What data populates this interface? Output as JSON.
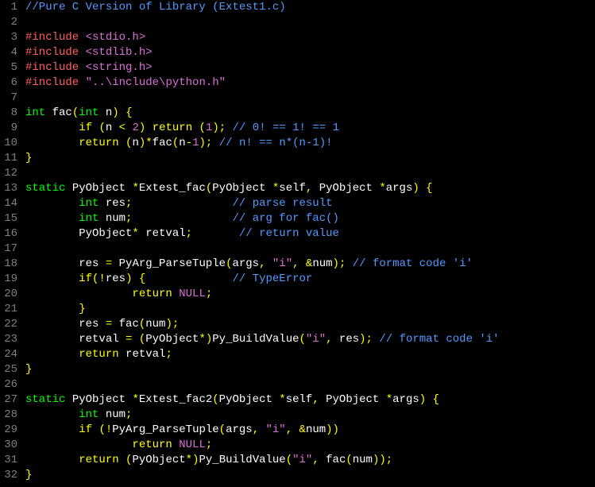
{
  "lines": [
    {
      "num": "1",
      "tokens": [
        {
          "t": "//Pure C Version of Library (Extest1.c)",
          "c": "c-blu"
        }
      ]
    },
    {
      "num": "2",
      "tokens": []
    },
    {
      "num": "3",
      "tokens": [
        {
          "t": "#include",
          "c": "c-red"
        },
        {
          "t": " ",
          "c": "c-white"
        },
        {
          "t": "<stdio.h>",
          "c": "c-purple"
        }
      ]
    },
    {
      "num": "4",
      "tokens": [
        {
          "t": "#include",
          "c": "c-red"
        },
        {
          "t": " ",
          "c": "c-white"
        },
        {
          "t": "<stdlib.h>",
          "c": "c-purple"
        }
      ]
    },
    {
      "num": "5",
      "tokens": [
        {
          "t": "#include",
          "c": "c-red"
        },
        {
          "t": " ",
          "c": "c-white"
        },
        {
          "t": "<string.h>",
          "c": "c-purple"
        }
      ]
    },
    {
      "num": "6",
      "tokens": [
        {
          "t": "#include",
          "c": "c-red"
        },
        {
          "t": " ",
          "c": "c-white"
        },
        {
          "t": "\"..\\include\\python.h\"",
          "c": "c-purple"
        }
      ]
    },
    {
      "num": "7",
      "tokens": []
    },
    {
      "num": "8",
      "tokens": [
        {
          "t": "int",
          "c": "c-green"
        },
        {
          "t": " ",
          "c": "c-white"
        },
        {
          "t": "fac",
          "c": "c-white"
        },
        {
          "t": "(",
          "c": "c-yellow"
        },
        {
          "t": "int",
          "c": "c-green"
        },
        {
          "t": " n",
          "c": "c-white"
        },
        {
          "t": ")",
          "c": "c-yellow"
        },
        {
          "t": " ",
          "c": "c-white"
        },
        {
          "t": "{",
          "c": "c-yellow"
        }
      ]
    },
    {
      "num": "9",
      "tokens": [
        {
          "t": "        ",
          "c": "c-white"
        },
        {
          "t": "if",
          "c": "c-yellow"
        },
        {
          "t": " ",
          "c": "c-white"
        },
        {
          "t": "(",
          "c": "c-yellow"
        },
        {
          "t": "n ",
          "c": "c-white"
        },
        {
          "t": "<",
          "c": "c-yellow"
        },
        {
          "t": " ",
          "c": "c-white"
        },
        {
          "t": "2",
          "c": "c-purple"
        },
        {
          "t": ")",
          "c": "c-yellow"
        },
        {
          "t": " ",
          "c": "c-white"
        },
        {
          "t": "return",
          "c": "c-yellow"
        },
        {
          "t": " ",
          "c": "c-white"
        },
        {
          "t": "(",
          "c": "c-yellow"
        },
        {
          "t": "1",
          "c": "c-purple"
        },
        {
          "t": ")",
          "c": "c-yellow"
        },
        {
          "t": ";",
          "c": "c-yellow"
        },
        {
          "t": " ",
          "c": "c-white"
        },
        {
          "t": "// 0! == 1! == 1",
          "c": "c-blu"
        }
      ]
    },
    {
      "num": "10",
      "tokens": [
        {
          "t": "        ",
          "c": "c-white"
        },
        {
          "t": "return",
          "c": "c-yellow"
        },
        {
          "t": " ",
          "c": "c-white"
        },
        {
          "t": "(",
          "c": "c-yellow"
        },
        {
          "t": "n",
          "c": "c-white"
        },
        {
          "t": ")*",
          "c": "c-yellow"
        },
        {
          "t": "fac",
          "c": "c-white"
        },
        {
          "t": "(",
          "c": "c-yellow"
        },
        {
          "t": "n",
          "c": "c-white"
        },
        {
          "t": "-",
          "c": "c-yellow"
        },
        {
          "t": "1",
          "c": "c-purple"
        },
        {
          "t": ");",
          "c": "c-yellow"
        },
        {
          "t": " ",
          "c": "c-white"
        },
        {
          "t": "// n! == n*(n-1)!",
          "c": "c-blu"
        }
      ]
    },
    {
      "num": "11",
      "tokens": [
        {
          "t": "}",
          "c": "c-yellow"
        }
      ]
    },
    {
      "num": "12",
      "tokens": []
    },
    {
      "num": "13",
      "tokens": [
        {
          "t": "static",
          "c": "c-green"
        },
        {
          "t": " PyObject ",
          "c": "c-white"
        },
        {
          "t": "*",
          "c": "c-yellow"
        },
        {
          "t": "Extest_fac",
          "c": "c-white"
        },
        {
          "t": "(",
          "c": "c-yellow"
        },
        {
          "t": "PyObject ",
          "c": "c-white"
        },
        {
          "t": "*",
          "c": "c-yellow"
        },
        {
          "t": "self",
          "c": "c-white"
        },
        {
          "t": ",",
          "c": "c-yellow"
        },
        {
          "t": " PyObject ",
          "c": "c-white"
        },
        {
          "t": "*",
          "c": "c-yellow"
        },
        {
          "t": "args",
          "c": "c-white"
        },
        {
          "t": ")",
          "c": "c-yellow"
        },
        {
          "t": " ",
          "c": "c-white"
        },
        {
          "t": "{",
          "c": "c-yellow"
        }
      ]
    },
    {
      "num": "14",
      "tokens": [
        {
          "t": "        ",
          "c": "c-white"
        },
        {
          "t": "int",
          "c": "c-green"
        },
        {
          "t": " res",
          "c": "c-white"
        },
        {
          "t": ";",
          "c": "c-yellow"
        },
        {
          "t": "               ",
          "c": "c-white"
        },
        {
          "t": "// parse result",
          "c": "c-blu"
        }
      ]
    },
    {
      "num": "15",
      "tokens": [
        {
          "t": "        ",
          "c": "c-white"
        },
        {
          "t": "int",
          "c": "c-green"
        },
        {
          "t": " num",
          "c": "c-white"
        },
        {
          "t": ";",
          "c": "c-yellow"
        },
        {
          "t": "               ",
          "c": "c-white"
        },
        {
          "t": "// arg for fac()",
          "c": "c-blu"
        }
      ]
    },
    {
      "num": "16",
      "tokens": [
        {
          "t": "        PyObject",
          "c": "c-white"
        },
        {
          "t": "*",
          "c": "c-yellow"
        },
        {
          "t": " retval",
          "c": "c-white"
        },
        {
          "t": ";",
          "c": "c-yellow"
        },
        {
          "t": "       ",
          "c": "c-white"
        },
        {
          "t": "// return value",
          "c": "c-blu"
        }
      ]
    },
    {
      "num": "17",
      "tokens": []
    },
    {
      "num": "18",
      "tokens": [
        {
          "t": "        res ",
          "c": "c-white"
        },
        {
          "t": "=",
          "c": "c-yellow"
        },
        {
          "t": " PyArg_ParseTuple",
          "c": "c-white"
        },
        {
          "t": "(",
          "c": "c-yellow"
        },
        {
          "t": "args",
          "c": "c-white"
        },
        {
          "t": ",",
          "c": "c-yellow"
        },
        {
          "t": " ",
          "c": "c-white"
        },
        {
          "t": "\"i\"",
          "c": "c-purple"
        },
        {
          "t": ",",
          "c": "c-yellow"
        },
        {
          "t": " ",
          "c": "c-white"
        },
        {
          "t": "&",
          "c": "c-yellow"
        },
        {
          "t": "num",
          "c": "c-white"
        },
        {
          "t": ");",
          "c": "c-yellow"
        },
        {
          "t": " ",
          "c": "c-white"
        },
        {
          "t": "// format code 'i'",
          "c": "c-blu"
        }
      ]
    },
    {
      "num": "19",
      "tokens": [
        {
          "t": "        ",
          "c": "c-white"
        },
        {
          "t": "if",
          "c": "c-yellow"
        },
        {
          "t": "(!",
          "c": "c-yellow"
        },
        {
          "t": "res",
          "c": "c-white"
        },
        {
          "t": ")",
          "c": "c-yellow"
        },
        {
          "t": " ",
          "c": "c-white"
        },
        {
          "t": "{",
          "c": "c-yellow"
        },
        {
          "t": "             ",
          "c": "c-white"
        },
        {
          "t": "// TypeError",
          "c": "c-blu"
        }
      ]
    },
    {
      "num": "20",
      "tokens": [
        {
          "t": "                ",
          "c": "c-white"
        },
        {
          "t": "return",
          "c": "c-yellow"
        },
        {
          "t": " ",
          "c": "c-white"
        },
        {
          "t": "NULL",
          "c": "c-purple"
        },
        {
          "t": ";",
          "c": "c-yellow"
        }
      ]
    },
    {
      "num": "21",
      "tokens": [
        {
          "t": "        ",
          "c": "c-white"
        },
        {
          "t": "}",
          "c": "c-yellow"
        }
      ]
    },
    {
      "num": "22",
      "tokens": [
        {
          "t": "        res ",
          "c": "c-white"
        },
        {
          "t": "=",
          "c": "c-yellow"
        },
        {
          "t": " fac",
          "c": "c-white"
        },
        {
          "t": "(",
          "c": "c-yellow"
        },
        {
          "t": "num",
          "c": "c-white"
        },
        {
          "t": ");",
          "c": "c-yellow"
        }
      ]
    },
    {
      "num": "23",
      "tokens": [
        {
          "t": "        retval ",
          "c": "c-white"
        },
        {
          "t": "=",
          "c": "c-yellow"
        },
        {
          "t": " ",
          "c": "c-white"
        },
        {
          "t": "(",
          "c": "c-yellow"
        },
        {
          "t": "PyObject",
          "c": "c-white"
        },
        {
          "t": "*)",
          "c": "c-yellow"
        },
        {
          "t": "Py_BuildValue",
          "c": "c-white"
        },
        {
          "t": "(",
          "c": "c-yellow"
        },
        {
          "t": "\"i\"",
          "c": "c-purple"
        },
        {
          "t": ",",
          "c": "c-yellow"
        },
        {
          "t": " res",
          "c": "c-white"
        },
        {
          "t": ");",
          "c": "c-yellow"
        },
        {
          "t": " ",
          "c": "c-white"
        },
        {
          "t": "// format code 'i'",
          "c": "c-blu"
        }
      ]
    },
    {
      "num": "24",
      "tokens": [
        {
          "t": "        ",
          "c": "c-white"
        },
        {
          "t": "return",
          "c": "c-yellow"
        },
        {
          "t": " retval",
          "c": "c-white"
        },
        {
          "t": ";",
          "c": "c-yellow"
        }
      ]
    },
    {
      "num": "25",
      "tokens": [
        {
          "t": "}",
          "c": "c-yellow"
        }
      ]
    },
    {
      "num": "26",
      "tokens": []
    },
    {
      "num": "27",
      "tokens": [
        {
          "t": "static",
          "c": "c-green"
        },
        {
          "t": " PyObject ",
          "c": "c-white"
        },
        {
          "t": "*",
          "c": "c-yellow"
        },
        {
          "t": "Extest_fac2",
          "c": "c-white"
        },
        {
          "t": "(",
          "c": "c-yellow"
        },
        {
          "t": "PyObject ",
          "c": "c-white"
        },
        {
          "t": "*",
          "c": "c-yellow"
        },
        {
          "t": "self",
          "c": "c-white"
        },
        {
          "t": ",",
          "c": "c-yellow"
        },
        {
          "t": " PyObject ",
          "c": "c-white"
        },
        {
          "t": "*",
          "c": "c-yellow"
        },
        {
          "t": "args",
          "c": "c-white"
        },
        {
          "t": ")",
          "c": "c-yellow"
        },
        {
          "t": " ",
          "c": "c-white"
        },
        {
          "t": "{",
          "c": "c-yellow"
        }
      ]
    },
    {
      "num": "28",
      "tokens": [
        {
          "t": "        ",
          "c": "c-white"
        },
        {
          "t": "int",
          "c": "c-green"
        },
        {
          "t": " num",
          "c": "c-white"
        },
        {
          "t": ";",
          "c": "c-yellow"
        }
      ]
    },
    {
      "num": "29",
      "tokens": [
        {
          "t": "        ",
          "c": "c-white"
        },
        {
          "t": "if",
          "c": "c-yellow"
        },
        {
          "t": " ",
          "c": "c-white"
        },
        {
          "t": "(!",
          "c": "c-yellow"
        },
        {
          "t": "PyArg_ParseTuple",
          "c": "c-white"
        },
        {
          "t": "(",
          "c": "c-yellow"
        },
        {
          "t": "args",
          "c": "c-white"
        },
        {
          "t": ",",
          "c": "c-yellow"
        },
        {
          "t": " ",
          "c": "c-white"
        },
        {
          "t": "\"i\"",
          "c": "c-purple"
        },
        {
          "t": ",",
          "c": "c-yellow"
        },
        {
          "t": " ",
          "c": "c-white"
        },
        {
          "t": "&",
          "c": "c-yellow"
        },
        {
          "t": "num",
          "c": "c-white"
        },
        {
          "t": "))",
          "c": "c-yellow"
        }
      ]
    },
    {
      "num": "30",
      "tokens": [
        {
          "t": "                ",
          "c": "c-white"
        },
        {
          "t": "return",
          "c": "c-yellow"
        },
        {
          "t": " ",
          "c": "c-white"
        },
        {
          "t": "NULL",
          "c": "c-purple"
        },
        {
          "t": ";",
          "c": "c-yellow"
        }
      ]
    },
    {
      "num": "31",
      "tokens": [
        {
          "t": "        ",
          "c": "c-white"
        },
        {
          "t": "return",
          "c": "c-yellow"
        },
        {
          "t": " ",
          "c": "c-white"
        },
        {
          "t": "(",
          "c": "c-yellow"
        },
        {
          "t": "PyObject",
          "c": "c-white"
        },
        {
          "t": "*)",
          "c": "c-yellow"
        },
        {
          "t": "Py_BuildValue",
          "c": "c-white"
        },
        {
          "t": "(",
          "c": "c-yellow"
        },
        {
          "t": "\"i\"",
          "c": "c-purple"
        },
        {
          "t": ",",
          "c": "c-yellow"
        },
        {
          "t": " fac",
          "c": "c-white"
        },
        {
          "t": "(",
          "c": "c-yellow"
        },
        {
          "t": "num",
          "c": "c-white"
        },
        {
          "t": "));",
          "c": "c-yellow"
        }
      ]
    },
    {
      "num": "32",
      "tokens": [
        {
          "t": "}",
          "c": "c-yellow"
        }
      ]
    }
  ]
}
